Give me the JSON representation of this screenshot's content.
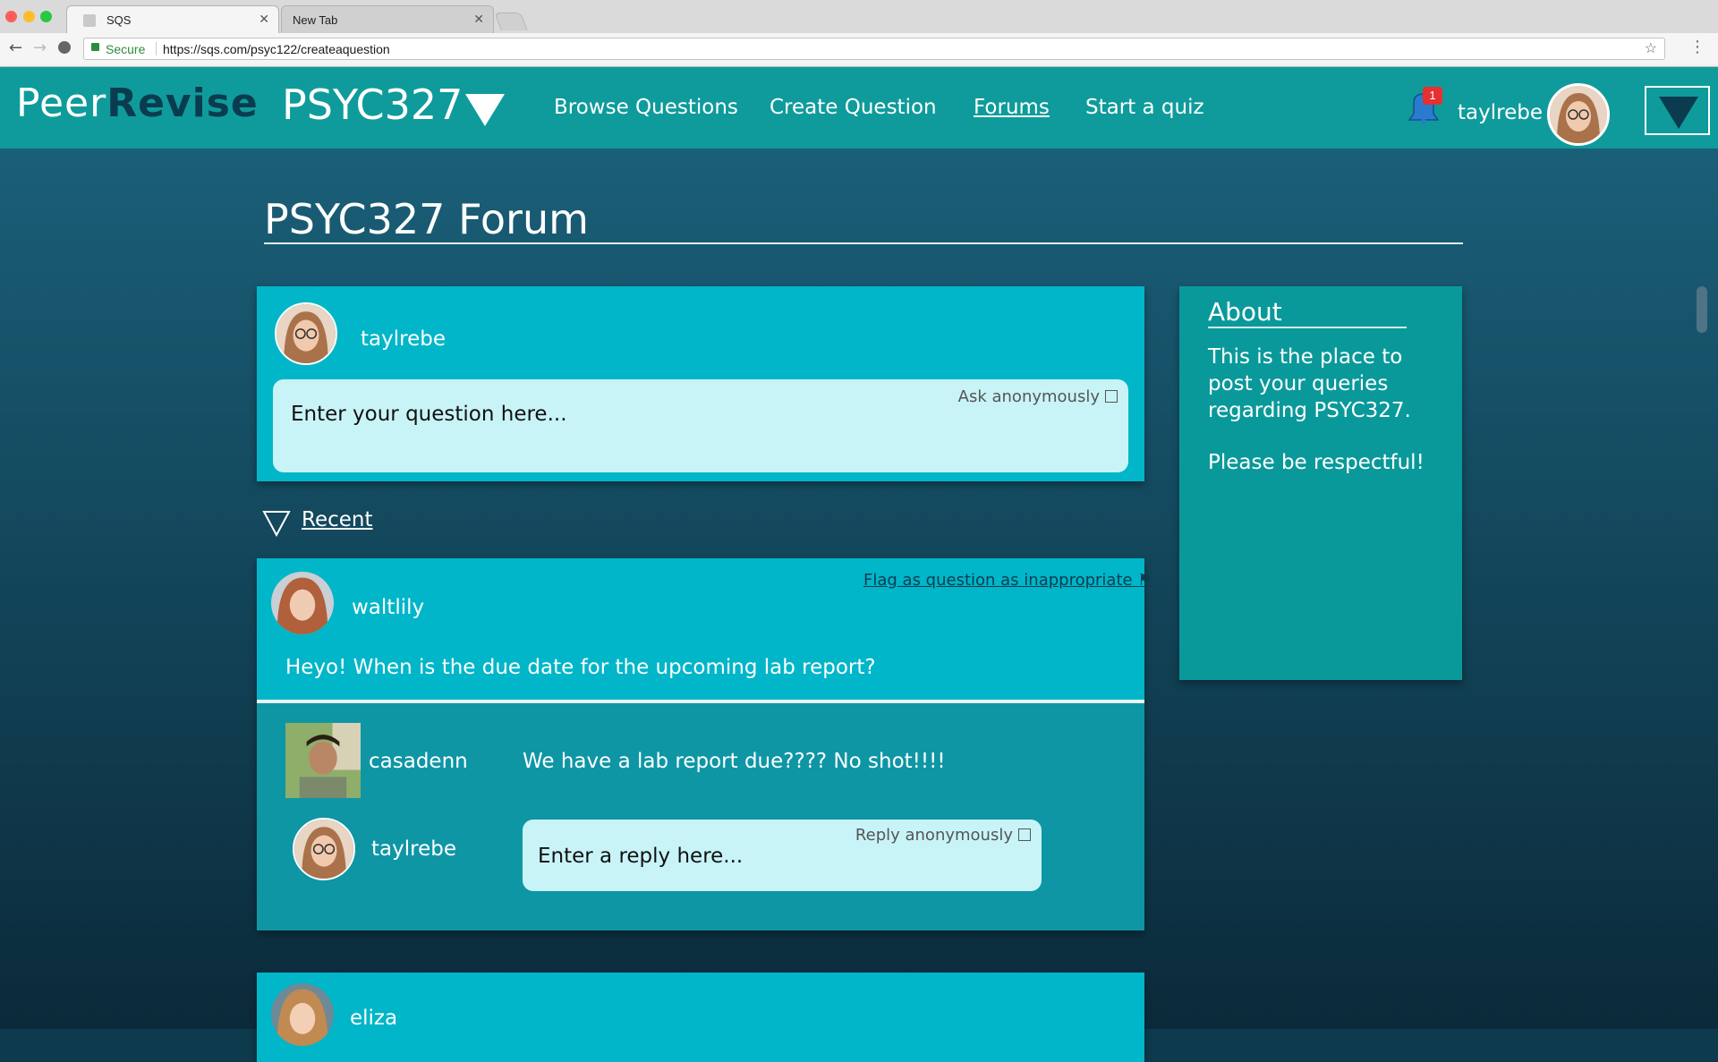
{
  "browser": {
    "tabs": [
      {
        "title": "SQS",
        "active": true
      },
      {
        "title": "New Tab",
        "active": false
      }
    ],
    "secure_label": "Secure",
    "url": "https://sqs.com/psyc122/createaquestion"
  },
  "header": {
    "logo_part1": "Peer",
    "logo_part2": "Revise",
    "course": "PSYC327",
    "nav": [
      "Browse Questions",
      "Create Question",
      "Forums",
      "Start a quiz"
    ],
    "active_nav": "Forums",
    "notification_count": "1",
    "username": "taylrebe"
  },
  "page": {
    "title": "PSYC327 Forum"
  },
  "composer": {
    "username": "taylrebe",
    "placeholder": "Enter your question here...",
    "anon_label": "Ask anonymously"
  },
  "about": {
    "title": "About",
    "text1": "This is the place to post your queries regarding PSYC327.",
    "text2": "Please be respectful!"
  },
  "sort": {
    "label": "Recent"
  },
  "posts": [
    {
      "username": "waltlily",
      "flag_label": "Flag as question as inappropriate",
      "question": "Heyo! When is the due date for the upcoming lab report?",
      "replies": [
        {
          "username": "casadenn",
          "text": "We have a lab report due???? No shot!!!!"
        }
      ],
      "reply_box": {
        "username": "taylrebe",
        "placeholder": "Enter a reply here...",
        "anon_label": "Reply anonymously"
      }
    },
    {
      "username": "eliza"
    }
  ],
  "colors": {
    "header_bg": "#0f9b9b",
    "card_bg": "#00b6c8",
    "input_bg": "#c8f4f8",
    "logo_dark": "#0a3b4f",
    "badge": "#e53030"
  }
}
